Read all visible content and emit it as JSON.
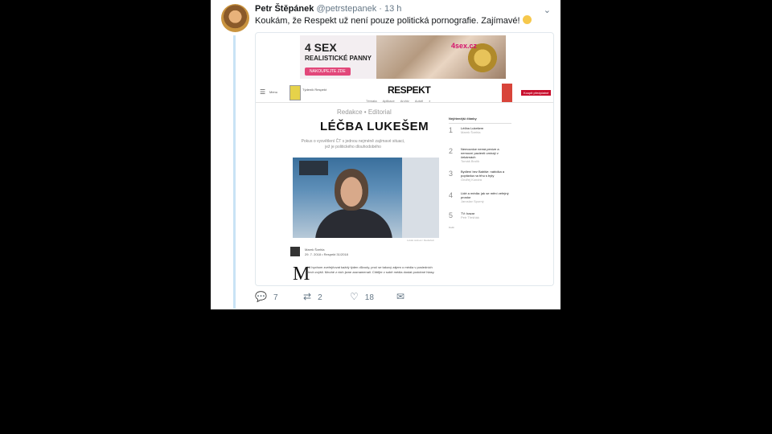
{
  "tweet": {
    "name": "Petr Štěpánek",
    "handle": "@petrstepanek",
    "time": "· 13 h",
    "text": "Koukám, že Respekt už není pouze politická pornografie. Zajímavé!",
    "replies": "7",
    "retweets": "2",
    "likes": "18"
  },
  "ad": {
    "line1": "4 SEX",
    "line2": "REALISTICKÉ PANNY",
    "button": "NAKOUPEJTE ZDE",
    "brand": "4sex.cz"
  },
  "site": {
    "menu": "Menu",
    "issue": "Týdeník Respekt",
    "logo": "RESPEKT",
    "nav": [
      "Témata",
      "Aplikace",
      "Archiv",
      "Autoři"
    ],
    "subscribe": "Koupit předplatné",
    "kicker": "Redakce • Editorial",
    "headline": "LÉČBA LUKEŠEM",
    "perex": "Pokus o vysvětlení ČT s jednou nejméně zajímavé situaci, jež je politického dlouhodobého",
    "photo_credit": "Lukáš Jelínek / Mediahub",
    "author": "Marek Švehla",
    "author_meta": "29. 7. 2018 • Respekt 31/2018",
    "dropcap": "M",
    "body": "ohli bychom zveřejňovat každý týden důvody, proč se takový zájem o média v posledních letech zvýšil. Mnohé z nich jsme zaznamenali. Chtějte v sobě média dostat podobné hlasy.",
    "aside_title": "Nejčtenější články",
    "popular": [
      {
        "num": "1",
        "title": "Léčba Lukešem",
        "author": "Marek Švehla"
      },
      {
        "num": "2",
        "title": "Nemocnice nemá peníze a nemocní pacienti umírají v čekárnách",
        "author": "Tomáš Brolík"
      },
      {
        "num": "3",
        "title": "Bydlení bez Babiše: nabídka a poptávka na trhu s byty",
        "author": "Ondřej Kundra"
      },
      {
        "num": "4",
        "title": "Lidé a média: jak se mění veřejný prostor",
        "author": "Jaroslav Spurný"
      },
      {
        "num": "5",
        "title": "TV: bazar",
        "author": "Petr Třešňák"
      }
    ],
    "more": "Další"
  }
}
